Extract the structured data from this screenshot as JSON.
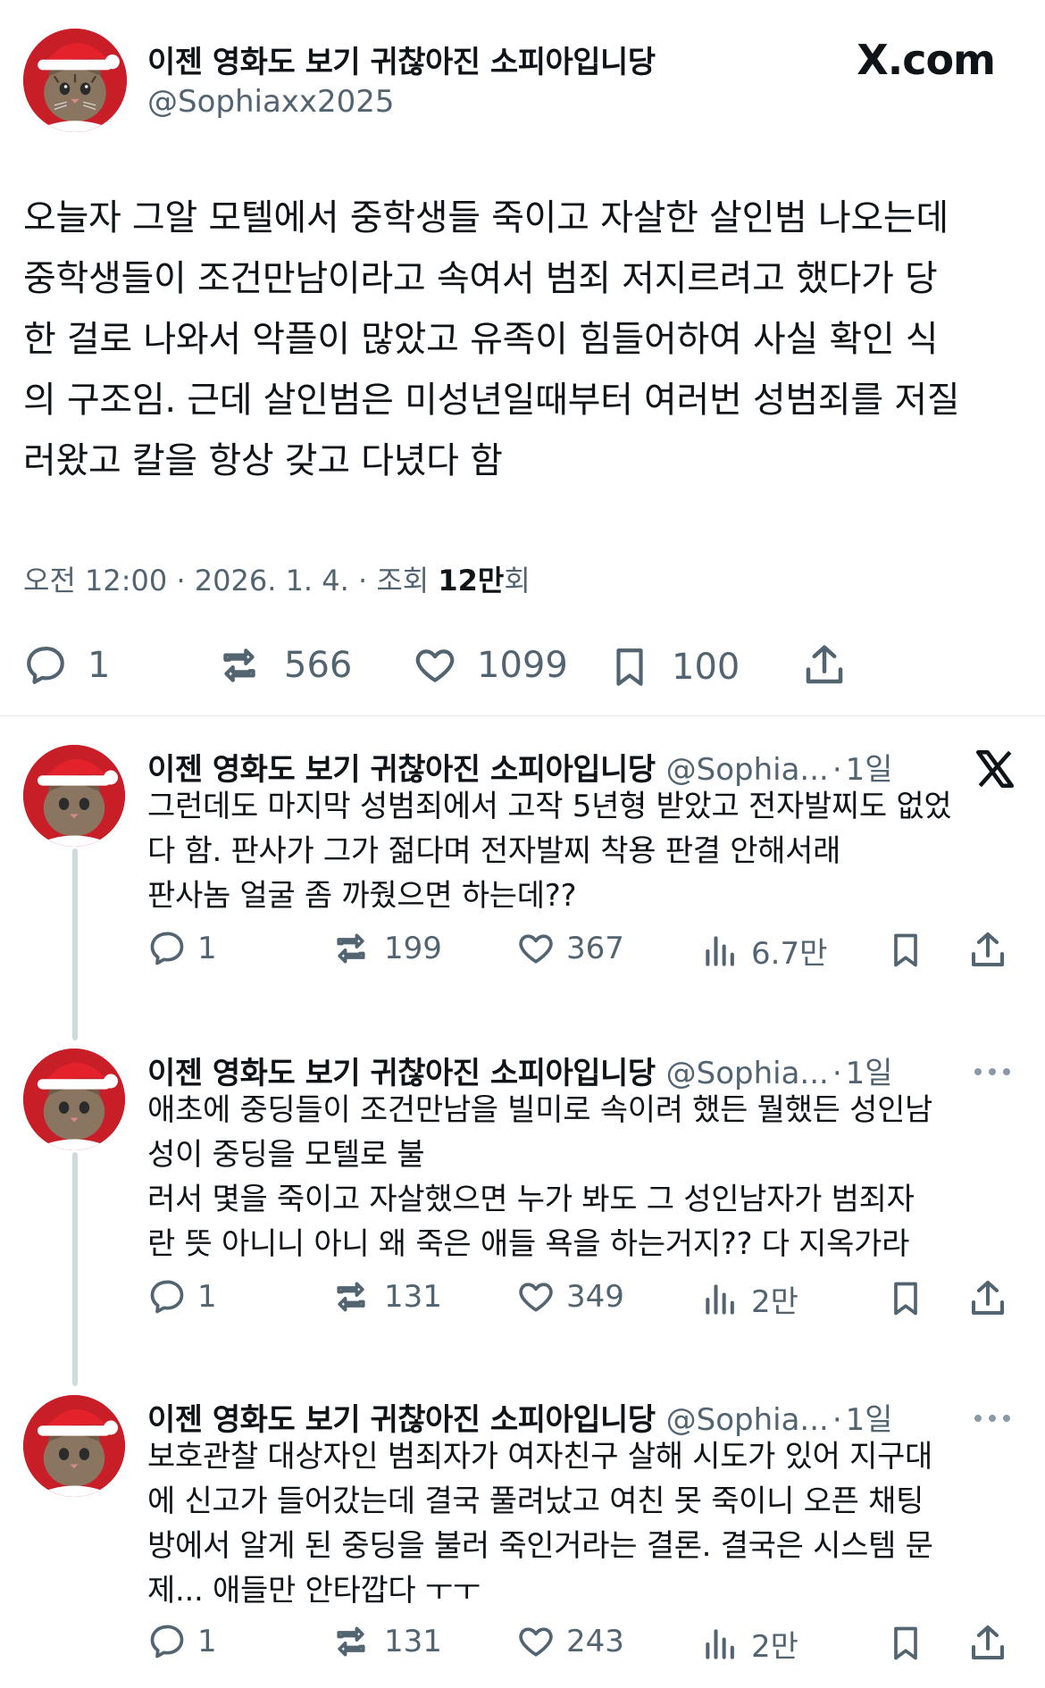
{
  "main_tweet": {
    "display_name": "이젠 영화도 보기 귀찮아진 소피아입니당",
    "handle": "@Sophiaxx2025",
    "brand_logo": "X.com",
    "text": "오늘자 그알 모텔에서 중학생들 죽이고 자살한 살인범 나오는데\n중학생들이 조건만남이라고 속여서 범죄 저지르려고 했다가 당\n한 걸로 나와서 악플이 많았고 유족이 힘들어하여 사실 확인 식\n의 구조임. 근데 살인범은 미성년일때부터 여러번 성범죄를 저질\n러왔고 칼을 항상 갖고 다녔다 함",
    "meta_time": "오전 12:00 · 2026. 1. 4. · 조회 ",
    "meta_views": "12만",
    "meta_suffix": "회",
    "stats": {
      "replies": "1",
      "retweets": "566",
      "likes": "1099",
      "bookmarks": "100"
    }
  },
  "replies": [
    {
      "display_name": "이젠 영화도 보기 귀찮아진 소피아입니당",
      "handle": "@Sophia...",
      "time": "1일",
      "text": "그런데도 마지막 성범죄에서 고작 5년형 받았고 전자발찌도 없었\n다 함. 판사가 그가 젊다며 전자발찌 착용 판결 안해서래\n판사놈 얼굴 좀 까줬으면 하는데??",
      "stats": {
        "replies": "1",
        "retweets": "199",
        "likes": "367",
        "views": "6.7만"
      },
      "corner_icon": "x-logo-icon"
    },
    {
      "display_name": "이젠 영화도 보기 귀찮아진 소피아입니당",
      "handle": "@Sophia...",
      "time": "1일",
      "text": "애초에 중딩들이 조건만남을 빌미로 속이려 했든 뭘했든 성인남\n성이 중딩을 모텔로 불\n러서 몇을 죽이고 자살했으면 누가 봐도 그 성인남자가 범죄자\n란 뜻 아니니 아니 왜 죽은 애들 욕을 하는거지?? 다 지옥가라",
      "stats": {
        "replies": "1",
        "retweets": "131",
        "likes": "349",
        "views": "2만"
      },
      "corner_icon": "more-icon"
    },
    {
      "display_name": "이젠 영화도 보기 귀찮아진 소피아입니당",
      "handle": "@Sophia...",
      "time": "1일",
      "text": "보호관찰 대상자인 범죄자가 여자친구 살해 시도가 있어 지구대\n에 신고가 들어갔는데 결국 풀려났고 여친 못 죽이니 오픈 채팅\n방에서 알게 된 중딩을 불러 죽인거라는 결론. 결국은 시스템 문\n제... 애들만 안타깝다 ㅜㅜ",
      "stats": {
        "replies": "1",
        "retweets": "131",
        "likes": "243",
        "views": "2만"
      },
      "corner_icon": "more-icon"
    }
  ],
  "colors": {
    "text": "#0f1419",
    "secondary": "#536471",
    "divider": "#e6e9ec",
    "thread_line": "#cfd9de",
    "avatar_hat": "#d41f2a"
  }
}
